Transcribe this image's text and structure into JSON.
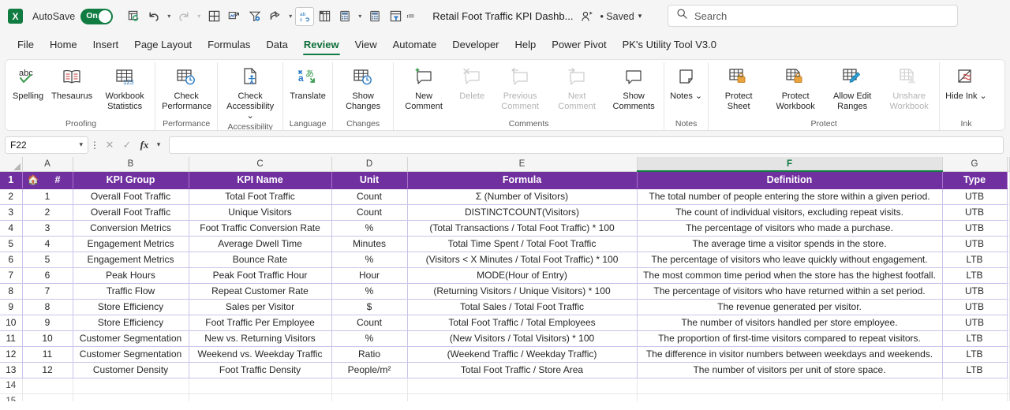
{
  "titlebar": {
    "app_logo": "excel-logo",
    "logo_letter": "X",
    "autosave_label": "AutoSave",
    "autosave_state": "On",
    "document_title": "Retail Foot Traffic KPI Dashb...",
    "saved_status": "• Saved",
    "quick_access": [
      {
        "name": "refresh-all-icon"
      },
      {
        "name": "undo-icon"
      },
      {
        "name": "undo-dropdown-caret"
      },
      {
        "name": "redo-icon"
      },
      {
        "name": "redo-dropdown-caret"
      },
      {
        "name": "borders-icon"
      },
      {
        "name": "chart-icon"
      },
      {
        "name": "filter-settings-icon"
      },
      {
        "name": "share-arrow-icon"
      },
      {
        "name": "share-dropdown-caret"
      },
      {
        "name": "spelling-abc-icon"
      },
      {
        "name": "pivot-table-icon"
      },
      {
        "name": "calculate-sheet-icon"
      },
      {
        "name": "calculate-dropdown-caret"
      },
      {
        "name": "calculate-now-icon"
      },
      {
        "name": "advanced-filter-icon"
      },
      {
        "name": "customize-qat-caret"
      }
    ],
    "search": {
      "placeholder": "Search",
      "icon": "search-icon"
    }
  },
  "tabs": [
    {
      "label": "File",
      "active": false
    },
    {
      "label": "Home",
      "active": false
    },
    {
      "label": "Insert",
      "active": false
    },
    {
      "label": "Page Layout",
      "active": false
    },
    {
      "label": "Formulas",
      "active": false
    },
    {
      "label": "Data",
      "active": false
    },
    {
      "label": "Review",
      "active": true
    },
    {
      "label": "View",
      "active": false
    },
    {
      "label": "Automate",
      "active": false
    },
    {
      "label": "Developer",
      "active": false
    },
    {
      "label": "Help",
      "active": false
    },
    {
      "label": "Power Pivot",
      "active": false
    },
    {
      "label": "PK's Utility Tool V3.0",
      "active": false
    }
  ],
  "ribbon": {
    "groups": [
      {
        "title": "Proofing",
        "items": [
          {
            "label": "Spelling",
            "icon": "spelling-check-icon",
            "disabled": false
          },
          {
            "label": "Thesaurus",
            "icon": "thesaurus-book-icon",
            "disabled": false
          },
          {
            "label": "Workbook Statistics",
            "icon": "workbook-statistics-icon",
            "disabled": false
          }
        ]
      },
      {
        "title": "Performance",
        "items": [
          {
            "label": "Check Performance",
            "icon": "check-performance-icon",
            "disabled": false
          }
        ]
      },
      {
        "title": "Accessibility",
        "items": [
          {
            "label": "Check Accessibility ⌄",
            "icon": "check-accessibility-icon",
            "disabled": false
          }
        ]
      },
      {
        "title": "Language",
        "items": [
          {
            "label": "Translate",
            "icon": "translate-icon",
            "disabled": false
          }
        ]
      },
      {
        "title": "Changes",
        "items": [
          {
            "label": "Show Changes",
            "icon": "show-changes-icon",
            "disabled": false
          }
        ]
      },
      {
        "title": "Comments",
        "items": [
          {
            "label": "New Comment",
            "icon": "new-comment-icon",
            "disabled": false
          },
          {
            "label": "Delete",
            "icon": "delete-comment-icon",
            "disabled": true
          },
          {
            "label": "Previous Comment",
            "icon": "previous-comment-icon",
            "disabled": true
          },
          {
            "label": "Next Comment",
            "icon": "next-comment-icon",
            "disabled": true
          },
          {
            "label": "Show Comments",
            "icon": "show-comments-icon",
            "disabled": false
          }
        ]
      },
      {
        "title": "Notes",
        "items": [
          {
            "label": "Notes ⌄",
            "icon": "notes-icon",
            "disabled": false
          }
        ]
      },
      {
        "title": "Protect",
        "items": [
          {
            "label": "Protect Sheet",
            "icon": "protect-sheet-icon",
            "disabled": false
          },
          {
            "label": "Protect Workbook",
            "icon": "protect-workbook-icon",
            "disabled": false
          },
          {
            "label": "Allow Edit Ranges",
            "icon": "allow-edit-ranges-icon",
            "disabled": false
          },
          {
            "label": "Unshare Workbook",
            "icon": "unshare-workbook-icon",
            "disabled": true
          }
        ]
      },
      {
        "title": "Ink",
        "items": [
          {
            "label": "Hide Ink ⌄",
            "icon": "hide-ink-icon",
            "disabled": false
          }
        ]
      }
    ]
  },
  "formula_bar": {
    "name_box_value": "F22",
    "cancel_icon": "cancel-x-icon",
    "enter_icon": "enter-check-icon",
    "fx_icon": "insert-function-icon",
    "formula_value": ""
  },
  "sheet": {
    "column_letters": [
      "A",
      "B",
      "C",
      "D",
      "E",
      "F",
      "G"
    ],
    "active_column": "F",
    "row_numbers": [
      "1",
      "2",
      "3",
      "4",
      "5",
      "6",
      "7",
      "8",
      "9",
      "10",
      "11",
      "12",
      "13",
      "14",
      "15"
    ],
    "header_accent": "#7030a0",
    "header_row": {
      "home_icon": "home-icon",
      "cells": [
        "#",
        "KPI Group",
        "KPI Name",
        "Unit",
        "Formula",
        "Definition",
        "Type"
      ]
    },
    "rows": [
      {
        "num": "1",
        "group": "Overall Foot Traffic",
        "kpi": "Total Foot Traffic",
        "unit": "Count",
        "formula": "Σ (Number of Visitors)",
        "definition": "The total number of people entering the store within a given period.",
        "type": "UTB"
      },
      {
        "num": "2",
        "group": "Overall Foot Traffic",
        "kpi": "Unique Visitors",
        "unit": "Count",
        "formula": "DISTINCTCOUNT(Visitors)",
        "definition": "The count of individual visitors, excluding repeat visits.",
        "type": "UTB"
      },
      {
        "num": "3",
        "group": "Conversion Metrics",
        "kpi": "Foot Traffic Conversion Rate",
        "unit": "%",
        "formula": "(Total Transactions / Total Foot Traffic) * 100",
        "definition": "The percentage of visitors who made a purchase.",
        "type": "UTB"
      },
      {
        "num": "4",
        "group": "Engagement Metrics",
        "kpi": "Average Dwell Time",
        "unit": "Minutes",
        "formula": "Total Time Spent / Total Foot Traffic",
        "definition": "The average time a visitor spends in the store.",
        "type": "UTB"
      },
      {
        "num": "5",
        "group": "Engagement Metrics",
        "kpi": "Bounce Rate",
        "unit": "%",
        "formula": "(Visitors < X Minutes / Total Foot Traffic) * 100",
        "definition": "The percentage of visitors who leave quickly without engagement.",
        "type": "LTB"
      },
      {
        "num": "6",
        "group": "Peak Hours",
        "kpi": "Peak Foot Traffic Hour",
        "unit": "Hour",
        "formula": "MODE(Hour of Entry)",
        "definition": "The most common time period when the store has the highest footfall.",
        "type": "LTB"
      },
      {
        "num": "7",
        "group": "Traffic Flow",
        "kpi": "Repeat Customer Rate",
        "unit": "%",
        "formula": "(Returning Visitors / Unique Visitors) * 100",
        "definition": "The percentage of visitors who have returned within a set period.",
        "type": "UTB"
      },
      {
        "num": "8",
        "group": "Store Efficiency",
        "kpi": "Sales per Visitor",
        "unit": "$",
        "formula": "Total Sales / Total Foot Traffic",
        "definition": "The revenue generated per visitor.",
        "type": "UTB"
      },
      {
        "num": "9",
        "group": "Store Efficiency",
        "kpi": "Foot Traffic Per Employee",
        "unit": "Count",
        "formula": "Total Foot Traffic / Total Employees",
        "definition": "The number of visitors handled per store employee.",
        "type": "UTB"
      },
      {
        "num": "10",
        "group": "Customer Segmentation",
        "kpi": "New vs. Returning Visitors",
        "unit": "%",
        "formula": "(New Visitors / Total Visitors) * 100",
        "definition": "The proportion of first-time visitors compared to repeat visitors.",
        "type": "LTB"
      },
      {
        "num": "11",
        "group": "Customer Segmentation",
        "kpi": "Weekend vs. Weekday Traffic",
        "unit": "Ratio",
        "formula": "(Weekend Traffic / Weekday Traffic)",
        "definition": "The difference in visitor numbers between weekdays and weekends.",
        "type": "LTB"
      },
      {
        "num": "12",
        "group": "Customer Density",
        "kpi": "Foot Traffic Density",
        "unit": "People/m²",
        "formula": "Total Foot Traffic / Store Area",
        "definition": "The number of visitors per unit of store space.",
        "type": "LTB"
      }
    ]
  }
}
